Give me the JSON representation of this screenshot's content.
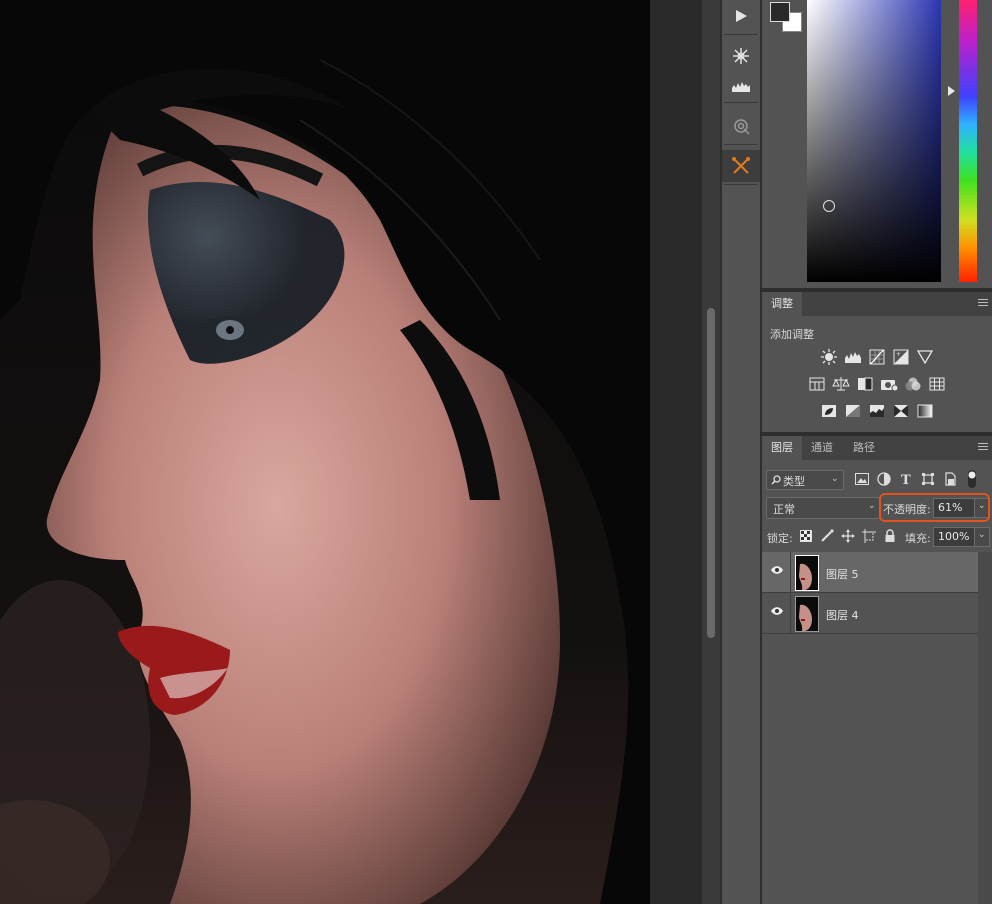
{
  "tools": {
    "items": [
      {
        "name": "play-icon"
      },
      {
        "name": "snowflake-icon"
      },
      {
        "name": "levels-icon"
      },
      {
        "name": "clone-source-icon"
      },
      {
        "name": "crossed-tools-icon",
        "selected": true
      }
    ]
  },
  "color_panel": {
    "foreground": "#2a2a2a",
    "background": "#ffffff",
    "hue_color": "#2b36b3"
  },
  "adjustments": {
    "tab_label": "调整",
    "title": "添加调整",
    "row1": [
      "brightness-icon",
      "levels-icon",
      "curves-icon",
      "exposure-icon",
      "vibrance-icon"
    ],
    "row2": [
      "hue-saturation-icon",
      "color-balance-icon",
      "black-white-icon",
      "photo-filter-icon",
      "channel-mixer-icon",
      "color-lookup-icon"
    ],
    "row3": [
      "invert-icon",
      "posterize-icon",
      "threshold-icon",
      "selective-color-icon",
      "gradient-map-icon"
    ]
  },
  "layers_panel": {
    "tabs": [
      {
        "label": "图层",
        "active": true
      },
      {
        "label": "通道",
        "active": false
      },
      {
        "label": "路径",
        "active": false
      }
    ],
    "filter_label": "类型",
    "blend_mode": "正常",
    "opacity_label": "不透明度:",
    "opacity_value": "61%",
    "lock_label": "锁定:",
    "fill_label": "填充:",
    "fill_value": "100%",
    "layers": [
      {
        "name": "图层 5",
        "selected": true,
        "visible": true
      },
      {
        "name": "图层 4",
        "selected": false,
        "visible": true
      }
    ]
  },
  "colors": {
    "highlight": "#e2531f",
    "panel_bg": "#535353",
    "active_tool": "#e07a20"
  }
}
